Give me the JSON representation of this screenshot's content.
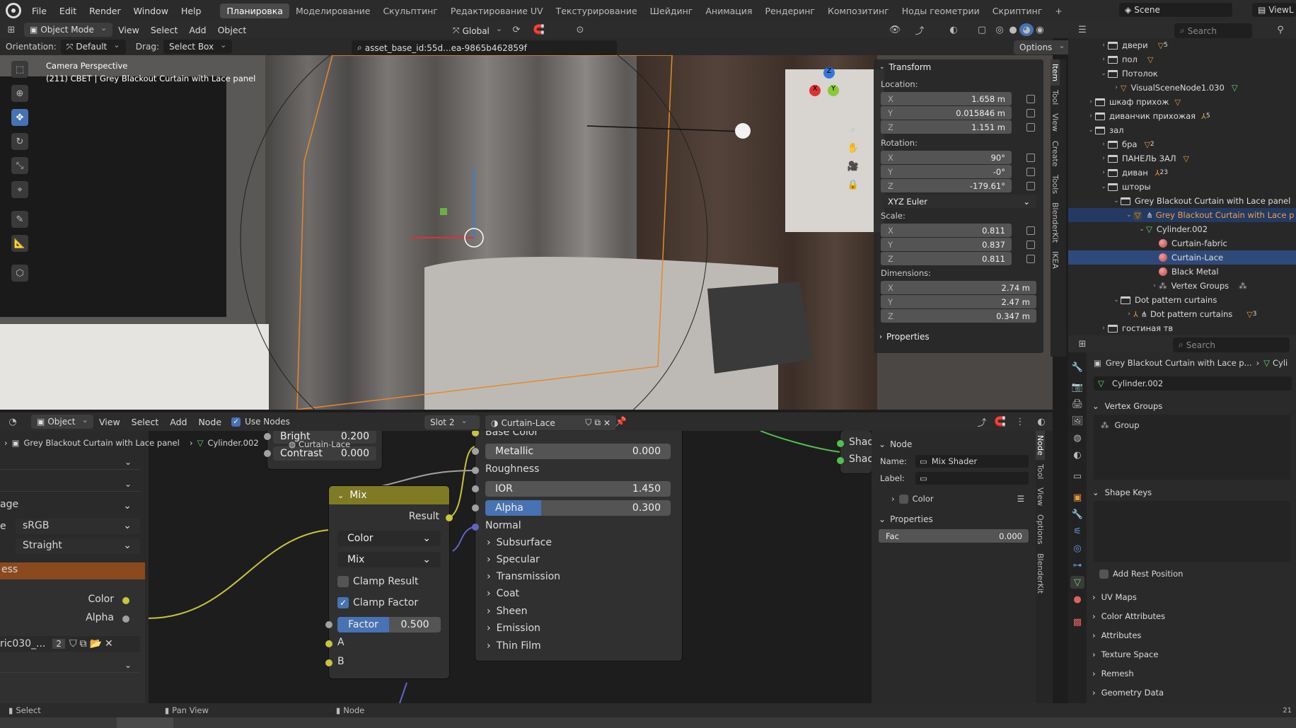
{
  "topbar": {
    "menus": [
      "File",
      "Edit",
      "Render",
      "Window",
      "Help"
    ],
    "workspaces": [
      "Планировка",
      "Моделирование",
      "Скульптинг",
      "Редактирование UV",
      "Текстурирование",
      "Шейдинг",
      "Анимация",
      "Рендеринг",
      "Композитинг",
      "Ноды геометрии",
      "Скриптинг"
    ],
    "active_workspace": "Планировка",
    "add_tab": "+",
    "scene": "Scene",
    "view_layer": "ViewL"
  },
  "viewport_header": {
    "mode": "Object Mode",
    "menus": [
      "View",
      "Select",
      "Add",
      "Object"
    ],
    "orientation_label": "Global",
    "orientation_row_label": "Orientation:",
    "orientation_value": "Default",
    "drag_label": "Drag:",
    "drag_value": "Select Box",
    "asset_text": "asset_base_id:55d...ea-9865b462859f",
    "options": "Options"
  },
  "viewport": {
    "camera_label": "Camera Perspective",
    "object_label": "(211) СВЕТ | Grey Blackout Curtain with Lace panel"
  },
  "n_panel": {
    "transform_title": "Transform",
    "location_label": "Location:",
    "location": [
      {
        "k": "X",
        "v": "1.658 m"
      },
      {
        "k": "Y",
        "v": "0.015846 m"
      },
      {
        "k": "Z",
        "v": "1.151 m"
      }
    ],
    "rotation_label": "Rotation:",
    "rotation": [
      {
        "k": "X",
        "v": "90°"
      },
      {
        "k": "Y",
        "v": "-0°"
      },
      {
        "k": "Z",
        "v": "-179.61°"
      }
    ],
    "euler": "XYZ Euler",
    "scale_label": "Scale:",
    "scale": [
      {
        "k": "X",
        "v": "0.811"
      },
      {
        "k": "Y",
        "v": "0.837"
      },
      {
        "k": "Z",
        "v": "0.811"
      }
    ],
    "dimensions_label": "Dimensions:",
    "dimensions": [
      {
        "k": "X",
        "v": "2.74 m"
      },
      {
        "k": "Y",
        "v": "2.47 m"
      },
      {
        "k": "Z",
        "v": "0.347 m"
      }
    ],
    "properties_title": "Properties",
    "tabs": [
      "Item",
      "Tool",
      "View",
      "Create",
      "Tools",
      "BlenderKit",
      "IKEA"
    ]
  },
  "outliner": {
    "search_placeholder": "Search",
    "rows": [
      {
        "label": "двери",
        "badge": "5"
      },
      {
        "label": "пол",
        "badge": ""
      },
      {
        "label": "Потолок",
        "badge": ""
      },
      {
        "label": "VisualSceneNode1.030",
        "badge": ""
      },
      {
        "label": "шкаф прихож",
        "badge": ""
      },
      {
        "label": "диванчик прихожая",
        "badge": "5"
      },
      {
        "label": "зал",
        "badge": ""
      },
      {
        "label": "бра",
        "badge": "2"
      },
      {
        "label": "ПАНЕЛЬ ЗАЛ",
        "badge": ""
      },
      {
        "label": "диван",
        "badge": "23"
      },
      {
        "label": "шторы",
        "badge": ""
      },
      {
        "label": "Grey Blackout Curtain with Lace panel",
        "badge": ""
      },
      {
        "label": "Grey Blackout Curtain with Lace p",
        "badge": ""
      },
      {
        "label": "Cylinder.002",
        "badge": ""
      },
      {
        "label": "Curtain-fabric",
        "badge": ""
      },
      {
        "label": "Curtain-Lace",
        "badge": ""
      },
      {
        "label": "Black Metal",
        "badge": ""
      },
      {
        "label": "Vertex Groups",
        "badge": ""
      },
      {
        "label": "Dot pattern curtains",
        "badge": ""
      },
      {
        "label": "Dot pattern curtains",
        "badge": "3"
      },
      {
        "label": "гостиная тв",
        "badge": ""
      }
    ]
  },
  "properties": {
    "search_placeholder": "Search",
    "breadcrumb_object": "Grey Blackout Curtain with Lace p...",
    "breadcrumb_mesh": "Cyli",
    "mesh_name": "Cylinder.002",
    "vertex_groups": "Vertex Groups",
    "group": "Group",
    "shape_keys": "Shape Keys",
    "add_rest_position": "Add Rest Position",
    "sections": [
      "UV Maps",
      "Color Attributes",
      "Attributes",
      "Texture Space",
      "Remesh",
      "Geometry Data"
    ]
  },
  "node_header": {
    "editor_type": "Object",
    "menus": [
      "View",
      "Select",
      "Add",
      "Node"
    ],
    "use_nodes": "Use Nodes",
    "slot": "Slot 2",
    "material": "Curtain-Lace",
    "breadcrumb_object": "Grey Blackout Curtain with Lace panel",
    "breadcrumb_mesh": "Cylinder.002",
    "breadcrumb_material": "Curtain-Lace"
  },
  "left_sidebar": {
    "image_label": "age",
    "colorspace_prefix": "e",
    "colorspace": "sRGB",
    "alpha": "Straight",
    "node_title": "ess",
    "color_out": "Color",
    "alpha_out": "Alpha",
    "image_name": "ric030_...",
    "users": "2"
  },
  "bright_node": {
    "bright_label": "Bright",
    "bright_value": "0.200",
    "contrast_label": "Contrast",
    "contrast_value": "0.000"
  },
  "mix_node": {
    "title": "Mix",
    "result": "Result",
    "data_type": "Color",
    "blend": "Mix",
    "clamp_result": "Clamp Result",
    "clamp_factor": "Clamp Factor",
    "factor_label": "Factor",
    "factor_value": "0.500",
    "a": "A",
    "b": "B"
  },
  "bsdf_node": {
    "base_color": "Base Color",
    "metallic_label": "Metallic",
    "metallic_value": "0.000",
    "roughness": "Roughness",
    "ior_label": "IOR",
    "ior_value": "1.450",
    "alpha_label": "Alpha",
    "alpha_value": "0.300",
    "normal": "Normal",
    "panels": [
      "Subsurface",
      "Specular",
      "Transmission",
      "Coat",
      "Sheen",
      "Emission",
      "Thin Film"
    ]
  },
  "output_stub": {
    "a": "Shad",
    "b": "Shad"
  },
  "node_panel": {
    "node_title": "Node",
    "name_label": "Name:",
    "name_value": "Mix Shader",
    "label_label": "Label:",
    "color": "Color",
    "properties": "Properties",
    "fac_label": "Fac",
    "fac_value": "0.000",
    "tabs": [
      "Node",
      "Tool",
      "View",
      "Options",
      "BlenderKit"
    ]
  },
  "statusbar": {
    "select": "Select",
    "pan": "Pan View",
    "node": "Node",
    "version": "21"
  }
}
